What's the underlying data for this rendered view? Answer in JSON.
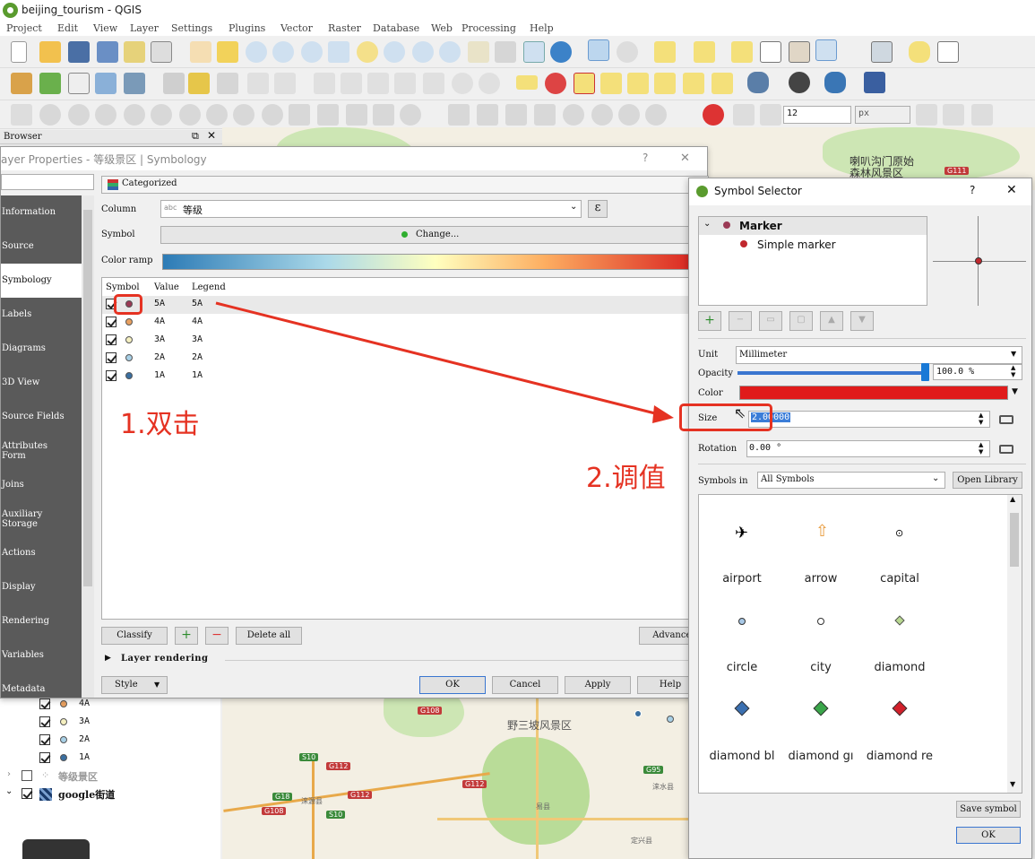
{
  "app": {
    "title": "beijing_tourism - QGIS"
  },
  "menu": [
    "Project",
    "Edit",
    "View",
    "Layer",
    "Settings",
    "Plugins",
    "Vector",
    "Raster",
    "Database",
    "Web",
    "Processing",
    "Help"
  ],
  "toolbar": {
    "snap_tolerance": "12",
    "snap_unit": "px"
  },
  "browser": {
    "title": "Browser"
  },
  "layers_panel": {
    "items": [
      {
        "label": "4A",
        "color": "#e8a060"
      },
      {
        "label": "3A",
        "color": "#f5f0c0"
      },
      {
        "label": "2A",
        "color": "#a8d0e6"
      },
      {
        "label": "1A",
        "color": "#3a6fa0"
      }
    ],
    "layer_scenic": "等级景区",
    "layer_google": "google街道"
  },
  "map_labels": {
    "top_right": "喇叭沟门原始森林风景区",
    "park": "野三坡风景区",
    "places": [
      "涞源县",
      "涞水县",
      "易县",
      "定兴县"
    ],
    "roads": [
      "G111",
      "G108",
      "S10",
      "G112",
      "G18",
      "G95",
      "G108",
      "G112",
      "G112",
      "S10"
    ]
  },
  "layer_props": {
    "title": "ayer Properties - 等级景区 | Symbology",
    "renderer": "Categorized",
    "column_label": "Column",
    "column_type": "abc",
    "column_value": "等级",
    "expression_icon": "ε",
    "symbol_label": "Symbol",
    "change_label": "Change...",
    "color_ramp_label": "Color ramp",
    "table_headers": [
      "Symbol",
      "Value",
      "Legend"
    ],
    "rows": [
      {
        "value": "5A",
        "legend": "5A",
        "color": "#9b3a55"
      },
      {
        "value": "4A",
        "legend": "4A",
        "color": "#e8a060"
      },
      {
        "value": "3A",
        "legend": "3A",
        "color": "#f5f0c0"
      },
      {
        "value": "2A",
        "legend": "2A",
        "color": "#a8d0e6"
      },
      {
        "value": "1A",
        "legend": "1A",
        "color": "#3a6fa0"
      }
    ],
    "nav": [
      "Information",
      "Source",
      "Symbology",
      "Labels",
      "Diagrams",
      "3D View",
      "Source Fields",
      "Attributes Form",
      "Joins",
      "Auxiliary Storage",
      "Actions",
      "Display",
      "Rendering",
      "Variables",
      "Metadata"
    ],
    "buttons": {
      "classify": "Classify",
      "delete_all": "Delete all",
      "advanced": "Advanced",
      "layer_rendering": "Layer rendering",
      "style": "Style",
      "ok": "OK",
      "cancel": "Cancel",
      "apply": "Apply",
      "help": "Help"
    }
  },
  "symbol_selector": {
    "title": "Symbol Selector",
    "tree": {
      "root": "Marker",
      "child": "Simple marker"
    },
    "unit_label": "Unit",
    "unit_value": "Millimeter",
    "opacity_label": "Opacity",
    "opacity_value": "100.0 %",
    "opacity_fraction": 1.0,
    "color_label": "Color",
    "color_value": "#e01b1b",
    "size_label": "Size",
    "size_value": "2.00000",
    "rotation_label": "Rotation",
    "rotation_value": "0.00 °",
    "symbols_in_label": "Symbols in",
    "symbols_in_value": "All Symbols",
    "open_library": "Open Library",
    "save_symbol": "Save symbol",
    "ok": "OK",
    "symbols": [
      {
        "name": "airport",
        "icon": "airport-icon"
      },
      {
        "name": "arrow",
        "icon": "arrow-icon"
      },
      {
        "name": "capital",
        "icon": "capital-icon"
      },
      {
        "name": "circle",
        "icon": "circle-icon"
      },
      {
        "name": "city",
        "icon": "city-icon"
      },
      {
        "name": "diamond",
        "icon": "diamond-icon"
      },
      {
        "name": "diamond bl",
        "icon": "diamond-blue-icon"
      },
      {
        "name": "diamond gı",
        "icon": "diamond-green-icon"
      },
      {
        "name": "diamond re",
        "icon": "diamond-red-icon"
      }
    ]
  },
  "annotations": {
    "step1": "1.双击",
    "step2": "2.调值"
  }
}
